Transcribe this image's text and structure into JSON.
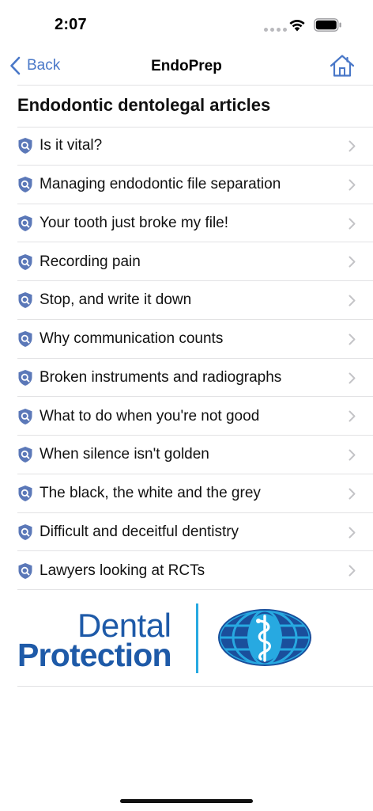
{
  "status_bar": {
    "time": "2:07"
  },
  "nav": {
    "back_label": "Back",
    "title": "EndoPrep"
  },
  "section": {
    "title": "Endodontic dentolegal articles"
  },
  "articles": [
    {
      "label": "Is it vital?"
    },
    {
      "label": "Managing endodontic file separation"
    },
    {
      "label": "Your tooth just broke my file!"
    },
    {
      "label": "Recording pain"
    },
    {
      "label": "Stop, and write it down"
    },
    {
      "label": "Why communication counts"
    },
    {
      "label": "Broken instruments and radiographs"
    },
    {
      "label": "What to do when you're not good"
    },
    {
      "label": "When silence isn't golden"
    },
    {
      "label": "The black, the white and the grey"
    },
    {
      "label": "Difficult and deceitful dentistry"
    },
    {
      "label": "Lawyers looking at RCTs"
    }
  ],
  "logo": {
    "line1": "Dental",
    "line2": "Protection"
  },
  "colors": {
    "accent": "#4a78c8",
    "logo_blue": "#1e5aa8",
    "logo_cyan": "#27a9e1"
  }
}
